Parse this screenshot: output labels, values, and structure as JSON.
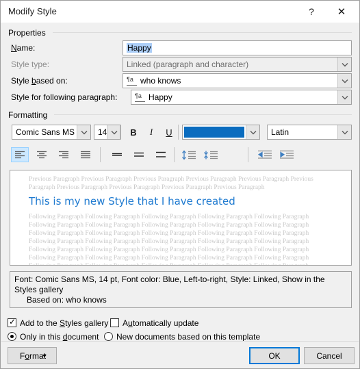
{
  "window": {
    "title": "Modify Style",
    "help_icon": "?",
    "close_icon": "✕"
  },
  "properties": {
    "group_label": "Properties",
    "name_label": "Name:",
    "name_value": "Happy",
    "style_type_label": "Style type:",
    "style_type_value": "Linked (paragraph and character)",
    "style_based_on_label": "Style based on:",
    "style_based_on_value": "who knows",
    "style_following_label": "Style for following paragraph:",
    "style_following_value": "Happy",
    "style_icon_glyph": "¶a"
  },
  "formatting": {
    "group_label": "Formatting",
    "font_family": "Comic Sans MS",
    "font_size": "14",
    "bold_label": "B",
    "italic_label": "I",
    "underline_label": "U",
    "font_color": "#0a6cbf",
    "script_value": "Latin",
    "align_buttons": [
      {
        "name": "align-left",
        "selected": true
      },
      {
        "name": "align-center",
        "selected": false
      },
      {
        "name": "align-right",
        "selected": false
      },
      {
        "name": "align-justify",
        "selected": false
      }
    ],
    "line_spacing_buttons": [
      {
        "name": "line-spacing-single"
      },
      {
        "name": "line-spacing-1-5"
      },
      {
        "name": "line-spacing-double"
      }
    ],
    "paragraph_space_buttons": [
      {
        "name": "decrease-paragraph-spacing"
      },
      {
        "name": "increase-paragraph-spacing"
      }
    ],
    "indent_buttons": [
      {
        "name": "decrease-indent"
      },
      {
        "name": "increase-indent"
      }
    ]
  },
  "preview": {
    "previous_paragraph": "Previous Paragraph Previous Paragraph Previous Paragraph Previous Paragraph Previous Paragraph Previous Paragraph Previous Paragraph Previous Paragraph Previous Paragraph Previous Paragraph",
    "sample_text": "This is my new Style that I have created",
    "following_paragraph": "Following Paragraph Following Paragraph Following Paragraph Following Paragraph Following Paragraph Following Paragraph Following Paragraph Following Paragraph Following Paragraph Following Paragraph Following Paragraph Following Paragraph Following Paragraph Following Paragraph Following Paragraph Following Paragraph Following Paragraph Following Paragraph Following Paragraph Following Paragraph Following Paragraph Following Paragraph Following Paragraph Following Paragraph Following Paragraph Following Paragraph Following Paragraph Following Paragraph Following Paragraph Following Paragraph Following Paragraph Following Paragraph Following Paragraph Following Paragraph Following Paragraph",
    "sample_color": "#1e7ad0"
  },
  "description": {
    "line1": "Font: Comic Sans MS, 14 pt, Font color: Blue, Left-to-right, Style: Linked, Show in the Styles gallery",
    "line2": "Based on: who knows"
  },
  "options": {
    "add_to_gallery_label": "Add to the Styles gallery",
    "add_to_gallery_checked": true,
    "automatically_update_label": "Automatically update",
    "automatically_update_checked": false,
    "only_this_document_label": "Only in this document",
    "only_this_document_selected": true,
    "new_documents_label": "New documents based on this template",
    "new_documents_selected": false,
    "check_mark": "✓"
  },
  "footer": {
    "format_label": "Format",
    "ok_label": "OK",
    "cancel_label": "Cancel",
    "focus_color": "#0078d7"
  }
}
